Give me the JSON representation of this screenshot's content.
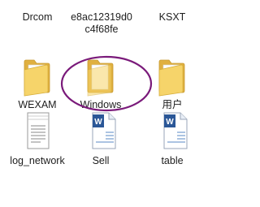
{
  "top_row": [
    {
      "label": "Drcom"
    },
    {
      "label": "e8ac12319d0c4f68fe"
    },
    {
      "label": "KSXT"
    }
  ],
  "middle_row": [
    {
      "label": "WEXAM",
      "icon": "folder-icon"
    },
    {
      "label": "Windows",
      "icon": "folder-icon"
    },
    {
      "label": "用户",
      "icon": "folder-icon"
    }
  ],
  "bottom_row": [
    {
      "label": "log_network",
      "icon": "text-document-icon"
    },
    {
      "label": "Sell",
      "icon": "word-document-icon"
    },
    {
      "label": "table",
      "icon": "word-document-icon"
    }
  ],
  "colors": {
    "folder_back": "#e6b94a",
    "folder_front": "#f7d774",
    "highlight_ellipse": "#7a1a7a",
    "word_blue": "#2b5797"
  }
}
